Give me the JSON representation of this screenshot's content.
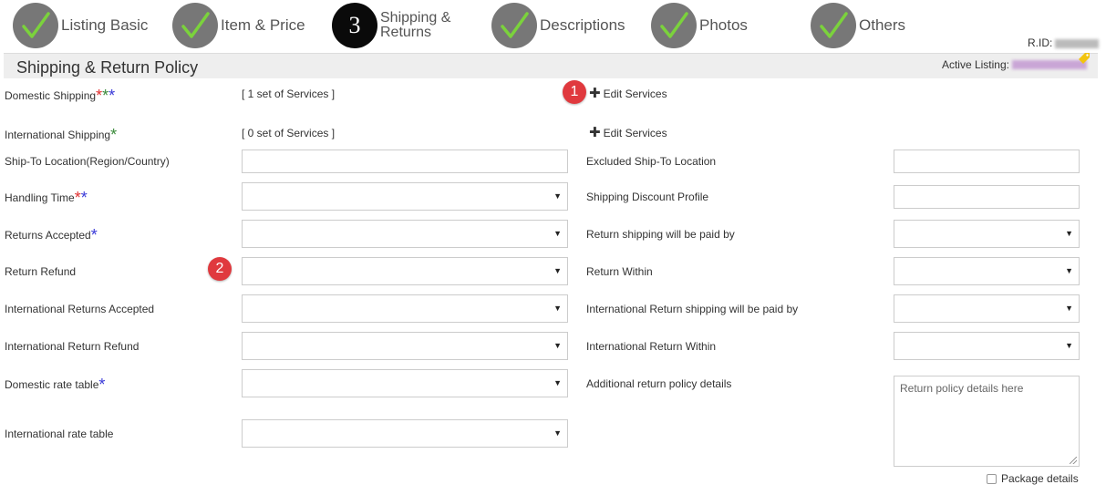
{
  "steps": [
    {
      "label": "Listing Basic",
      "state": "done"
    },
    {
      "label": "Item & Price",
      "state": "done"
    },
    {
      "number": "3",
      "line1": "Shipping &",
      "line2": "Returns",
      "state": "current"
    },
    {
      "label": "Descriptions",
      "state": "done"
    },
    {
      "label": "Photos",
      "state": "done"
    },
    {
      "label": "Others",
      "state": "done"
    }
  ],
  "rid_label": "R.ID:",
  "section": {
    "title": "Shipping & Return Policy",
    "active_label": "Active Listing:"
  },
  "badges": [
    "1",
    "2"
  ],
  "left": {
    "domestic_shipping": {
      "label": "Domestic Shipping",
      "info": "[ 1 set of Services ]",
      "edit": "Edit Services"
    },
    "international_shipping": {
      "label": "International Shipping",
      "info": "[ 0 set of Services ]",
      "edit": "Edit Services"
    },
    "ship_to_location": "Ship-To Location(Region/Country)",
    "handling_time": "Handling Time",
    "returns_accepted": "Returns Accepted",
    "return_refund": "Return Refund",
    "intl_returns_accepted": "International Returns Accepted",
    "intl_return_refund": "International Return Refund",
    "domestic_rate_table": "Domestic rate table",
    "intl_rate_table": "International rate table"
  },
  "right": {
    "excluded_ship_to": "Excluded Ship-To Location",
    "shipping_discount": "Shipping Discount Profile",
    "return_shipping_paid": "Return shipping will be paid by",
    "return_within": "Return Within",
    "intl_return_shipping_paid": "International Return shipping will be paid by",
    "intl_return_within": "International Return Within",
    "additional_details": "Additional return policy details",
    "additional_placeholder": "Return policy details here",
    "package_details": "Package details"
  },
  "asterisk": "*",
  "select_arrow": "▼",
  "plus": "✚",
  "colors": {
    "check": "#7bd23c",
    "required_red": "#e03030",
    "required_blue": "#3a3ad8",
    "required_green": "#3a8a3a",
    "badge": "#e0393e"
  }
}
